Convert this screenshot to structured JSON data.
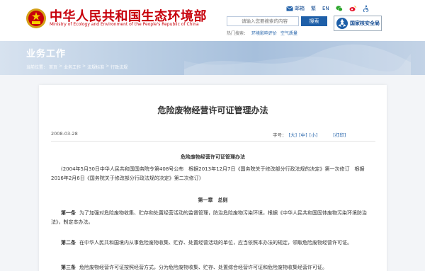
{
  "header": {
    "org_name_cn": "中华人民共和国生态环境部",
    "org_name_en": "Ministry of Ecology and Environment of the People's Republic of China",
    "toolbar": {
      "mail": "邮箱",
      "traditional": "繁",
      "english": "EN"
    },
    "search": {
      "placeholder": "请输入您要搜索的内容",
      "button": "搜索"
    },
    "hotwords": {
      "label": "热门搜索：",
      "items": [
        "环境影响评价",
        "空气质量"
      ]
    },
    "badge": "国家核安全局",
    "colors": {
      "brand_red": "#c7000b",
      "brand_blue": "#1e5fa8"
    }
  },
  "banner": {
    "title": "业务工作",
    "breadcrumb": {
      "label": "当前位置：",
      "items": [
        "首页",
        "业务工作",
        "法规标准",
        "行政法规"
      ],
      "separator": ">"
    }
  },
  "article": {
    "title": "危险废物经营许可证管理办法",
    "date": "2008-03-28",
    "font_size_label": "字号：",
    "font_sizes": [
      "[大]",
      "[中]",
      "[小]"
    ],
    "print": "[打印]",
    "doc_title": "危险废物经营许可证管理办法",
    "preface": "(2004年5月30日中华人民共和国国务院令第408号公布　根据2013年12月7日《国务院关于修改部分行政法规的决定》第一次修订　根据2016年2月6日《国务院关于修改部分行政法规的决定》第二次修订)",
    "chapter": "第一章　总则",
    "articles": [
      {
        "no": "第一条",
        "text": "为了加强对危险废物收集、贮存和处置经营活动的监督管理，防治危险废物污染环境，根据《中华人民共和国固体废物污染环境防治法》，制定本办法。"
      },
      {
        "no": "第二条",
        "text": "在中华人民共和国境内从事危险废物收集、贮存、处置经营活动的单位，应当依照本办法的规定，领取危险废物经营许可证。"
      },
      {
        "no": "第三条",
        "text": "危险废物经营许可证按照经营方式，分为危险废物收集、贮存、处置综合经营许可证和危险废物收集经营许可证。"
      }
    ]
  }
}
